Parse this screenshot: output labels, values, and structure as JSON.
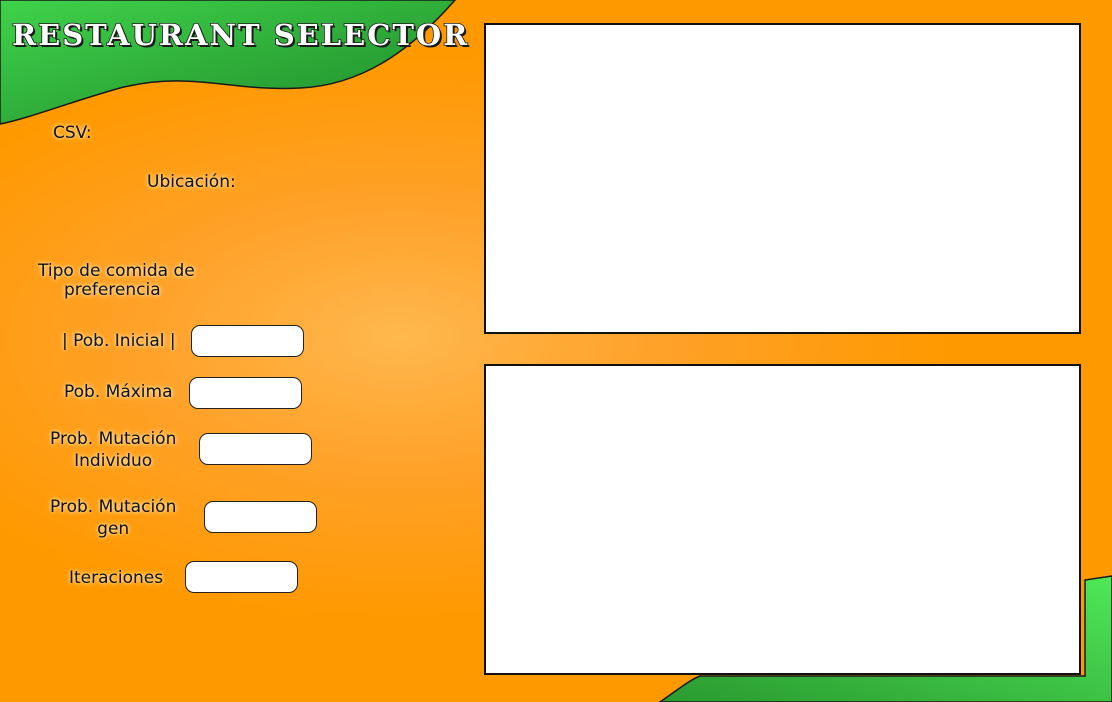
{
  "app": {
    "title": "RESTAURANT SELECTOR"
  },
  "colors": {
    "background": "#ff9900",
    "accent_green": "#2fb53a",
    "panel_bg": "#ffffff"
  },
  "labels": {
    "csv": "CSV:",
    "ubicacion": "Ubicación:",
    "tipo_line1": "Tipo de comida de",
    "tipo_line2": "preferencia",
    "pob_inicial": "| Pob. Inicial |",
    "pob_maxima": "Pob. Máxima",
    "prob_ind_line1": "Prob. Mutación",
    "prob_ind_line2": "Individuo",
    "prob_gen_line1": "Prob. Mutación",
    "prob_gen_line2": "gen",
    "iteraciones": "Iteraciones"
  },
  "fields": {
    "pob_inicial": {
      "value": ""
    },
    "pob_maxima": {
      "value": ""
    },
    "prob_mut_individuo": {
      "value": ""
    },
    "prob_mut_gen": {
      "value": ""
    },
    "iteraciones": {
      "value": ""
    }
  }
}
